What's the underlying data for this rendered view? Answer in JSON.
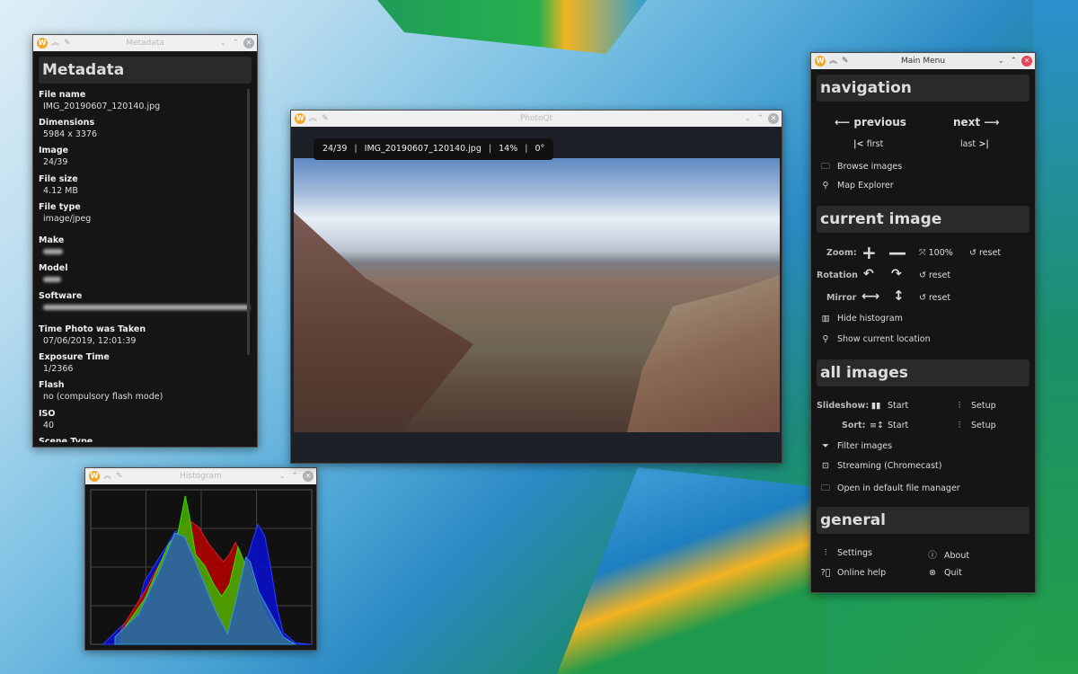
{
  "metadata_window": {
    "title": "Metadata",
    "heading": "Metadata",
    "fields": [
      {
        "key": "File name",
        "value": "IMG_20190607_120140.jpg"
      },
      {
        "key": "Dimensions",
        "value": "5984 x 3376"
      },
      {
        "key": "Image",
        "value": "24/39"
      },
      {
        "key": "File size",
        "value": "4.12 MB"
      },
      {
        "key": "File type",
        "value": "image/jpeg"
      },
      {
        "key": "Make",
        "value": ""
      },
      {
        "key": "Model",
        "value": ""
      },
      {
        "key": "Software",
        "value": ""
      },
      {
        "key": "Time Photo was Taken",
        "value": "07/06/2019, 12:01:39"
      },
      {
        "key": "Exposure Time",
        "value": "1/2366"
      },
      {
        "key": "Flash",
        "value": "no (compulsory flash mode)"
      },
      {
        "key": "ISO",
        "value": "40"
      },
      {
        "key": "Scene Type",
        "value": ""
      }
    ]
  },
  "histogram_window": {
    "title": "Histogram",
    "colors": {
      "red": "#b00000",
      "green": "#44aa00",
      "blue": "#0a10c8",
      "luminance": "#2d5fa8"
    },
    "curves": {
      "blue": [
        [
          14,
          0
        ],
        [
          35,
          0.12
        ],
        [
          52,
          0.2
        ],
        [
          62,
          0.42
        ],
        [
          76,
          0.55
        ],
        [
          87,
          0.65
        ],
        [
          97,
          0.75
        ],
        [
          104,
          0.77
        ],
        [
          111,
          0.75
        ],
        [
          125,
          0.52
        ],
        [
          139,
          0.35
        ],
        [
          149,
          0.2
        ],
        [
          158,
          0.08
        ],
        [
          167,
          0.2
        ],
        [
          173,
          0.5
        ],
        [
          182,
          0.6
        ],
        [
          187,
          0.7
        ],
        [
          193,
          0.8
        ],
        [
          201,
          0.72
        ],
        [
          208,
          0.5
        ],
        [
          215,
          0.25
        ],
        [
          222,
          0.08
        ],
        [
          236,
          0.01
        ],
        [
          255,
          0
        ]
      ],
      "red": [
        [
          35,
          0.1
        ],
        [
          62,
          0.35
        ],
        [
          90,
          0.65
        ],
        [
          104,
          0.77
        ],
        [
          113,
          0.83
        ],
        [
          125,
          0.78
        ],
        [
          135,
          0.68
        ],
        [
          146,
          0.6
        ],
        [
          153,
          0.55
        ],
        [
          160,
          0.6
        ],
        [
          167,
          0.68
        ],
        [
          173,
          0.6
        ],
        [
          180,
          0.5
        ],
        [
          191,
          0.3
        ],
        [
          208,
          0.1
        ],
        [
          229,
          0
        ]
      ],
      "green": [
        [
          35,
          0.08
        ],
        [
          62,
          0.3
        ],
        [
          90,
          0.67
        ],
        [
          101,
          0.75
        ],
        [
          109,
          0.99
        ],
        [
          114,
          0.85
        ],
        [
          121,
          0.6
        ],
        [
          132,
          0.52
        ],
        [
          142,
          0.4
        ],
        [
          151,
          0.32
        ],
        [
          160,
          0.4
        ],
        [
          170,
          0.65
        ],
        [
          177,
          0.55
        ],
        [
          180,
          0.55
        ],
        [
          187,
          0.45
        ],
        [
          201,
          0.2
        ],
        [
          219,
          0.05
        ],
        [
          236,
          0
        ]
      ],
      "luminance": [
        [
          28,
          0.05
        ],
        [
          55,
          0.2
        ],
        [
          80,
          0.5
        ],
        [
          97,
          0.74
        ],
        [
          108,
          0.72
        ],
        [
          121,
          0.55
        ],
        [
          135,
          0.35
        ],
        [
          146,
          0.2
        ],
        [
          158,
          0.07
        ],
        [
          170,
          0.35
        ],
        [
          179,
          0.58
        ],
        [
          184,
          0.55
        ],
        [
          194,
          0.35
        ],
        [
          208,
          0.2
        ],
        [
          222,
          0.05
        ],
        [
          236,
          0
        ]
      ]
    }
  },
  "viewer_window": {
    "title": "PhotoQt",
    "info_bar": {
      "position": "24/39",
      "filename": "IMG_20190607_120140.jpg",
      "zoom": "14%",
      "rotation": "0°"
    }
  },
  "main_menu": {
    "title": "Main Menu",
    "navigation": {
      "heading": "navigation",
      "previous": "previous",
      "next": "next",
      "first": "first",
      "last": "last",
      "browse": "Browse images",
      "map": "Map Explorer"
    },
    "current_image": {
      "heading": "current image",
      "zoom_label": "Zoom:",
      "zoom_100": "100%",
      "reset": "reset",
      "rotation_label": "Rotation",
      "mirror_label": "Mirror",
      "hide_histogram": "Hide histogram",
      "show_location": "Show current location"
    },
    "all_images": {
      "heading": "all images",
      "slideshow_label": "Slideshow:",
      "sort_label": "Sort:",
      "start": "Start",
      "setup": "Setup",
      "filter": "Filter images",
      "streaming": "Streaming (Chromecast)",
      "open_fm": "Open in default file manager"
    },
    "general": {
      "heading": "general",
      "settings": "Settings",
      "about": "About",
      "help": "Online help",
      "quit": "Quit"
    }
  }
}
